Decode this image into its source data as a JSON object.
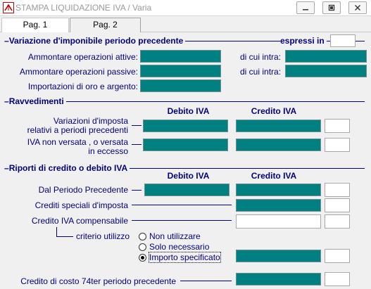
{
  "window": {
    "title": "STAMPA LIQUIDAZIONE IVA / Varia",
    "controls": [
      "minimize",
      "restore",
      "close"
    ]
  },
  "tabs": [
    {
      "label": "Pag. 1",
      "active": true
    },
    {
      "label": "Pag. 2",
      "active": false
    }
  ],
  "section_variazione": {
    "title": "Variazione d'imponibile periodo precedente",
    "espressi_label": "espressi in",
    "espressi_value": "",
    "rows": [
      {
        "label": "Ammontare operazioni attive:",
        "value": "",
        "intra_label": "di cui intra:",
        "intra_value": ""
      },
      {
        "label": "Ammontare operazioni passive:",
        "value": "",
        "intra_label": "di cui intra:",
        "intra_value": ""
      },
      {
        "label": "Importazioni di oro e argento:",
        "value": ""
      }
    ]
  },
  "section_ravvedimenti": {
    "title": "Ravvedimenti",
    "col_debito": "Debito IVA",
    "col_credito": "Credito IVA",
    "rows": [
      {
        "label_line1": "Variazioni d'imposta",
        "label_line2": "relativi a periodi precedenti",
        "debito": "",
        "credito": "",
        "extra": ""
      },
      {
        "label_line1": "IVA non versata , o versata",
        "label_line2": "in eccesso",
        "debito": "",
        "credito": "",
        "extra": ""
      }
    ]
  },
  "section_riporti": {
    "title": "Riporti di credito o debito IVA",
    "col_debito": "Debito IVA",
    "col_credito": "Credito IVA",
    "dal_periodo_label": "Dal Periodo Precedente",
    "crediti_speciali_label": "Crediti speciali d'imposta",
    "credito_compensabile_label": "Credito IVA compensabile",
    "criterio_label": "criterio utilizzo",
    "radio_options": [
      {
        "label": "Non utilizzare",
        "checked": false
      },
      {
        "label": "Solo necessario",
        "checked": false
      },
      {
        "label": "Importo specificato",
        "checked": true
      }
    ],
    "credito_74ter_label": "Credito di costo 74ter periodo precedente"
  },
  "colors": {
    "field_teal": "#008080",
    "label_navy": "#000080",
    "window_bg": "#f0f0f0"
  }
}
